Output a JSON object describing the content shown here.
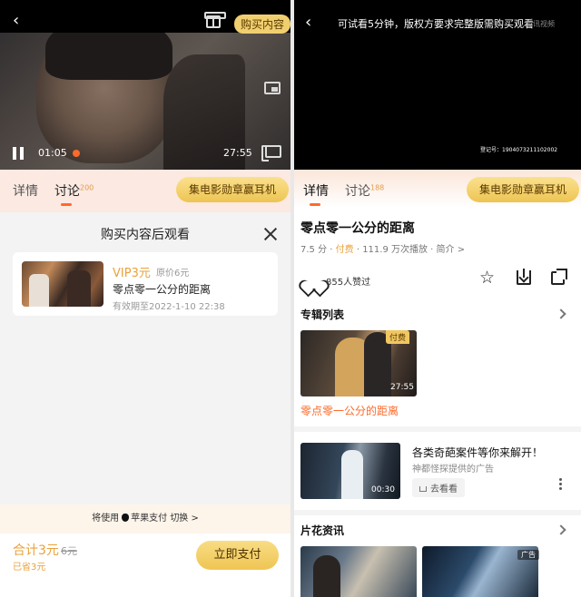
{
  "left": {
    "header": {
      "buy_label": "购买内容"
    },
    "player": {
      "current_time": "01:05",
      "total_time": "27:55"
    },
    "tabs": [
      {
        "label": "详情",
        "count": ""
      },
      {
        "label": "讨论",
        "count": "200"
      }
    ],
    "badge_button": "集电影勋章赢耳机",
    "sheet": {
      "title": "购买内容后观看",
      "item": {
        "vip_price": "VIP3元",
        "orig_price": "原价6元",
        "title": "零点零一公分的距离",
        "valid": "有效期至2022-1-10 22:38"
      },
      "pay_switch": {
        "prefix": "将使用",
        "method": "苹果支付",
        "action": "切换 >"
      },
      "total": "合计3元",
      "total_orig": "6元",
      "saved": "已省3元",
      "pay_button": "立即支付"
    }
  },
  "right": {
    "player": {
      "trial_text": "可试看5分钟，版权方要求完整版需购买观看",
      "watermark": "腾讯视频",
      "reg_no": "登记号：1904073211102002"
    },
    "tabs": [
      {
        "label": "详情",
        "count": ""
      },
      {
        "label": "讨论",
        "count": "188"
      }
    ],
    "badge_button": "集电影勋章赢耳机",
    "title": "零点零一公分的距离",
    "meta": {
      "score": "7.5 分",
      "paid": "付费",
      "plays": "111.9 万次播放",
      "intro": "简介 >"
    },
    "likes": "855人赞过",
    "album": {
      "section": "专辑列表",
      "tag": "付费",
      "duration": "27:55",
      "episode_title": "零点零一公分的距离"
    },
    "ad": {
      "title": "各类奇葩案件等你来解开！",
      "subtitle": "神都怪探提供的广告",
      "button": "去看看",
      "duration": "00:30"
    },
    "clips": {
      "section": "片花资讯",
      "ad_tag": "广告"
    }
  }
}
